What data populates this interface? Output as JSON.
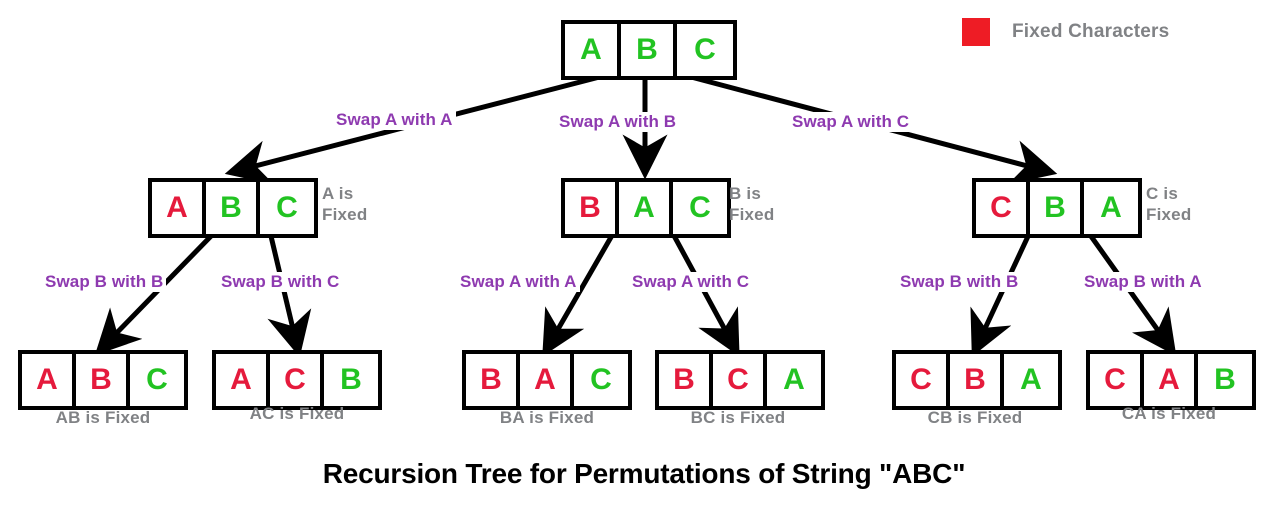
{
  "title": "Recursion Tree for Permutations of String \"ABC\"",
  "colors": {
    "fixed": "#e51a3c",
    "free": "#22c322",
    "swap_label": "#8e3ab0",
    "note": "#808285",
    "legend_swatch": "#ee1c25",
    "edge": "#000000",
    "background": "#ffffff"
  },
  "legend": {
    "swatch_color": "#ee1c25",
    "label": "Fixed Characters"
  },
  "tree": {
    "root": {
      "id": "root",
      "cells": [
        {
          "letter": "A",
          "state": "free"
        },
        {
          "letter": "B",
          "state": "free"
        },
        {
          "letter": "C",
          "state": "free"
        }
      ],
      "side_note": ""
    },
    "level1": [
      {
        "id": "l1-a",
        "cells": [
          {
            "letter": "A",
            "state": "fixed"
          },
          {
            "letter": "B",
            "state": "free"
          },
          {
            "letter": "C",
            "state": "free"
          }
        ],
        "side_note": "A is\nFixed"
      },
      {
        "id": "l1-b",
        "cells": [
          {
            "letter": "B",
            "state": "fixed"
          },
          {
            "letter": "A",
            "state": "free"
          },
          {
            "letter": "C",
            "state": "free"
          }
        ],
        "side_note": "B is\nFixed"
      },
      {
        "id": "l1-c",
        "cells": [
          {
            "letter": "C",
            "state": "fixed"
          },
          {
            "letter": "B",
            "state": "free"
          },
          {
            "letter": "A",
            "state": "free"
          }
        ],
        "side_note": "C is\nFixed"
      }
    ],
    "level2": [
      {
        "id": "l2-ab",
        "cells": [
          {
            "letter": "A",
            "state": "fixed"
          },
          {
            "letter": "B",
            "state": "fixed"
          },
          {
            "letter": "C",
            "state": "free"
          }
        ],
        "caption": "AB is Fixed"
      },
      {
        "id": "l2-ac",
        "cells": [
          {
            "letter": "A",
            "state": "fixed"
          },
          {
            "letter": "C",
            "state": "fixed"
          },
          {
            "letter": "B",
            "state": "free"
          }
        ],
        "caption": "AC is Fixed"
      },
      {
        "id": "l2-ba",
        "cells": [
          {
            "letter": "B",
            "state": "fixed"
          },
          {
            "letter": "A",
            "state": "fixed"
          },
          {
            "letter": "C",
            "state": "free"
          }
        ],
        "caption": "BA is Fixed"
      },
      {
        "id": "l2-bc",
        "cells": [
          {
            "letter": "B",
            "state": "fixed"
          },
          {
            "letter": "C",
            "state": "fixed"
          },
          {
            "letter": "A",
            "state": "free"
          }
        ],
        "caption": "BC is Fixed"
      },
      {
        "id": "l2-cb",
        "cells": [
          {
            "letter": "C",
            "state": "fixed"
          },
          {
            "letter": "B",
            "state": "fixed"
          },
          {
            "letter": "A",
            "state": "free"
          }
        ],
        "caption": "CB is Fixed"
      },
      {
        "id": "l2-ca",
        "cells": [
          {
            "letter": "C",
            "state": "fixed"
          },
          {
            "letter": "A",
            "state": "fixed"
          },
          {
            "letter": "B",
            "state": "free"
          }
        ],
        "caption": "CA is Fixed"
      }
    ],
    "edge_labels": {
      "root_to_a": "Swap A with A",
      "root_to_b": "Swap A with B",
      "root_to_c": "Swap A with C",
      "a_to_ab": "Swap B with B",
      "a_to_ac": "Swap B with C",
      "b_to_ba": "Swap A with A",
      "b_to_bc": "Swap A with C",
      "c_to_cb": "Swap B with B",
      "c_to_ca": "Swap B with A"
    }
  }
}
